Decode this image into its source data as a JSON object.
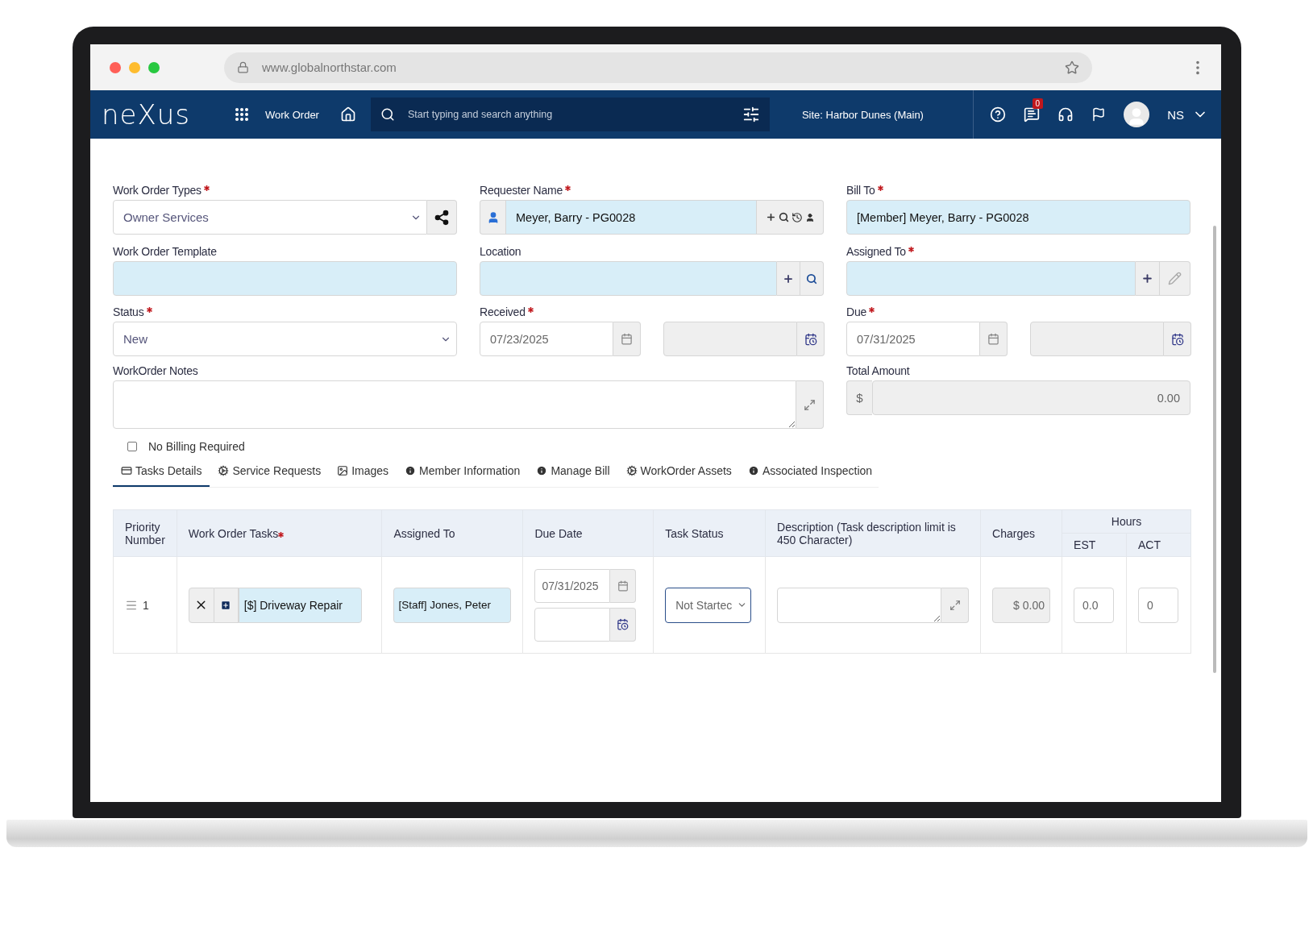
{
  "browser": {
    "url": "www.globalnorthstar.com"
  },
  "nav": {
    "logo": "neXus",
    "menu_label": "Work Order",
    "search_placeholder": "Start typing and search anything",
    "site": "Site: Harbor Dunes (Main)",
    "notification_count": "0",
    "user_initials": "NS"
  },
  "form": {
    "work_order_types": {
      "label": "Work Order Types",
      "required": true,
      "value": "Owner Services"
    },
    "requester_name": {
      "label": "Requester Name",
      "required": true,
      "value": "Meyer, Barry - PG0028"
    },
    "bill_to": {
      "label": "Bill To",
      "required": true,
      "value": "[Member] Meyer, Barry - PG0028"
    },
    "work_order_template": {
      "label": "Work Order Template",
      "required": false
    },
    "location": {
      "label": "Location",
      "required": false
    },
    "assigned_to": {
      "label": "Assigned To",
      "required": true
    },
    "status": {
      "label": "Status",
      "required": true,
      "value": "New"
    },
    "received": {
      "label": "Received",
      "required": true,
      "date": "07/23/2025"
    },
    "due": {
      "label": "Due",
      "required": true,
      "date": "07/31/2025"
    },
    "notes": {
      "label": "WorkOrder Notes",
      "required": false
    },
    "total_amount": {
      "label": "Total Amount",
      "required": false,
      "currency": "$",
      "value": "0.00"
    },
    "no_billing": {
      "label": "No Billing Required",
      "checked": false
    }
  },
  "tabs": [
    {
      "label": "Tasks Details",
      "kind": "card",
      "selected": true
    },
    {
      "label": "Service Requests",
      "kind": "gears",
      "selected": false
    },
    {
      "label": "Images",
      "kind": "image",
      "selected": false
    },
    {
      "label": "Member Information",
      "kind": "info",
      "selected": false
    },
    {
      "label": "Manage Bill",
      "kind": "info",
      "selected": false
    },
    {
      "label": "WorkOrder Assets",
      "kind": "gears",
      "selected": false
    },
    {
      "label": "Associated Inspection",
      "kind": "info",
      "selected": false
    }
  ],
  "table": {
    "columns": [
      {
        "label": "Priority Number",
        "required": false
      },
      {
        "label": "Work Order Tasks",
        "required": true
      },
      {
        "label": "Assigned To",
        "required": false
      },
      {
        "label": "Due Date",
        "required": false
      },
      {
        "label": "Task Status",
        "required": false
      },
      {
        "label": "Description (Task description limit is 450 Character)",
        "required": false
      },
      {
        "label": "Charges",
        "required": false
      }
    ],
    "hours_group": {
      "label": "Hours",
      "columns": [
        "EST",
        "ACT"
      ]
    },
    "rows": [
      {
        "priority": "1",
        "task": "[$] Driveway Repair",
        "assigned_to": "[Staff] Jones, Peter",
        "due_date": "07/31/2025",
        "status": "Not Startec",
        "charges": "$ 0.00",
        "est": "0.0",
        "act": "0"
      }
    ]
  }
}
